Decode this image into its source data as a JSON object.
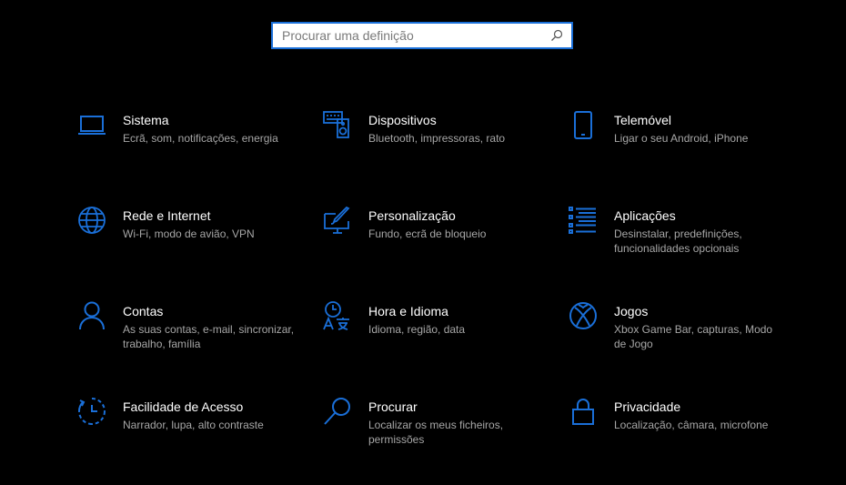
{
  "search": {
    "placeholder": "Procurar uma definição",
    "value": ""
  },
  "accent_color": "#1a6fd8",
  "tiles": [
    {
      "title": "Sistema",
      "desc": "Ecrã, som, notificações, energia",
      "icon": "laptop-icon"
    },
    {
      "title": "Dispositivos",
      "desc": "Bluetooth, impressoras, rato",
      "icon": "keyboard-speaker-icon"
    },
    {
      "title": "Telemóvel",
      "desc": "Ligar o seu Android, iPhone",
      "icon": "phone-icon"
    },
    {
      "title": "Rede e Internet",
      "desc": "Wi-Fi, modo de avião, VPN",
      "icon": "globe-icon"
    },
    {
      "title": "Personalização",
      "desc": "Fundo, ecrã de bloqueio",
      "icon": "paint-brush-icon"
    },
    {
      "title": "Aplicações",
      "desc": "Desinstalar, predefinições, funcionalidades opcionais",
      "icon": "apps-list-icon"
    },
    {
      "title": "Contas",
      "desc": "As suas contas, e-mail, sincronizar, trabalho, família",
      "icon": "person-icon"
    },
    {
      "title": "Hora e Idioma",
      "desc": "Idioma, região, data",
      "icon": "time-language-icon"
    },
    {
      "title": "Jogos",
      "desc": "Xbox Game Bar, capturas, Modo de Jogo",
      "icon": "xbox-icon"
    },
    {
      "title": "Facilidade de Acesso",
      "desc": "Narrador, lupa, alto contraste",
      "icon": "ease-of-access-icon"
    },
    {
      "title": "Procurar",
      "desc": "Localizar os meus ficheiros, permissões",
      "icon": "search-magnifier-icon"
    },
    {
      "title": "Privacidade",
      "desc": "Localização, câmara, microfone",
      "icon": "lock-icon"
    }
  ]
}
